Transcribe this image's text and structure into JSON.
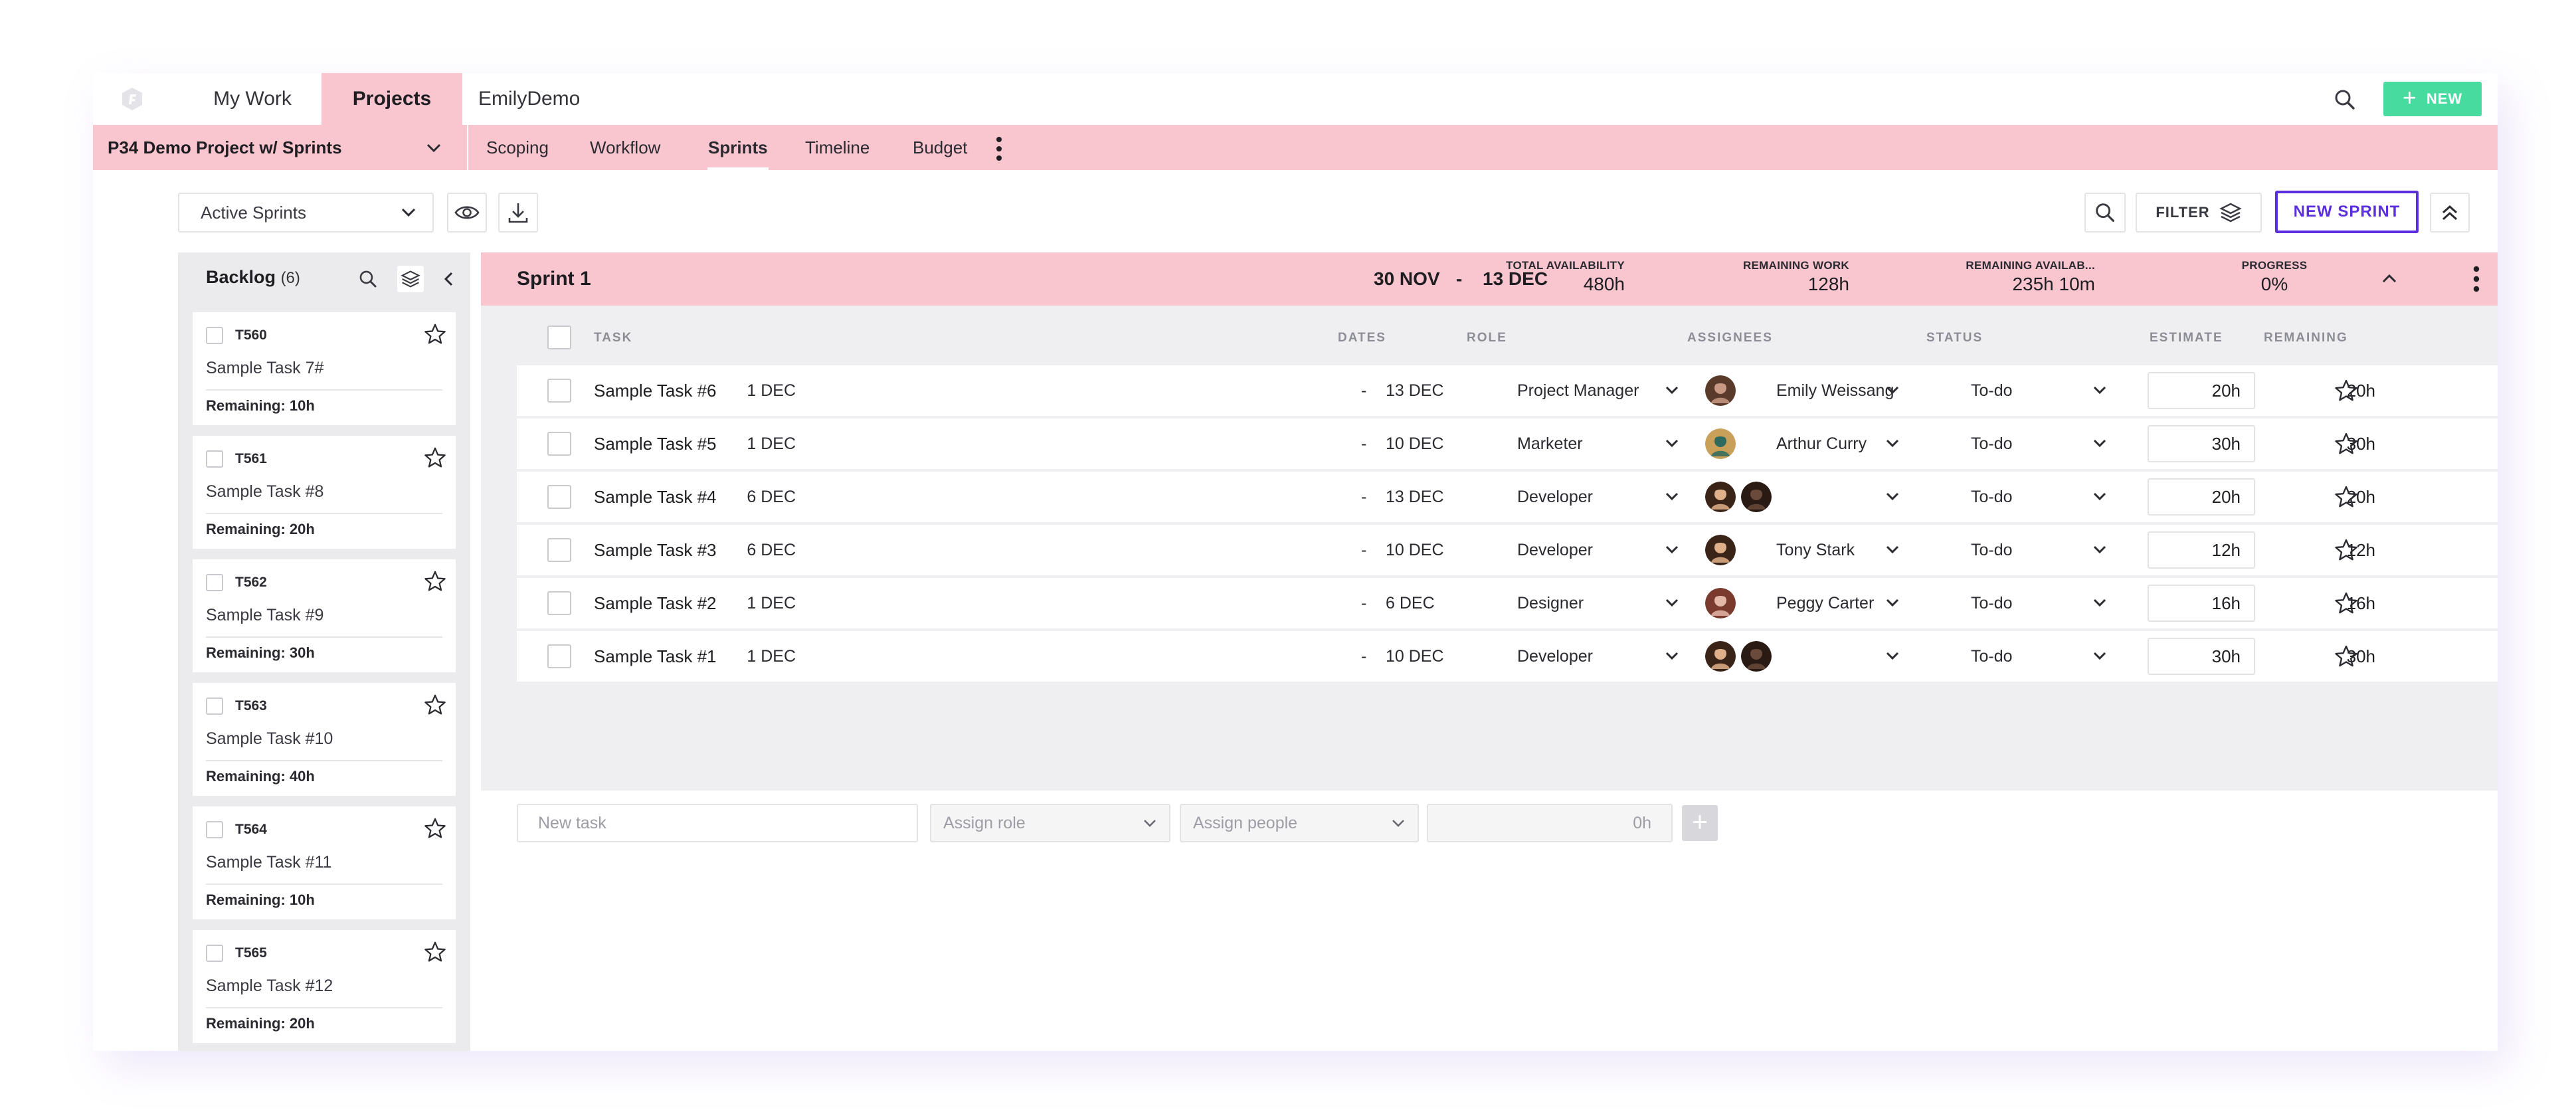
{
  "nav": {
    "tabs": [
      {
        "label": "My Work",
        "active": false
      },
      {
        "label": "Projects",
        "active": true
      },
      {
        "label": "EmilyDemo",
        "active": false
      }
    ],
    "new_button": "NEW"
  },
  "project": {
    "title": "P34 Demo Project w/ Sprints",
    "subtabs": [
      {
        "label": "Scoping",
        "active": false
      },
      {
        "label": "Workflow",
        "active": false
      },
      {
        "label": "Sprints",
        "active": true
      },
      {
        "label": "Timeline",
        "active": false
      },
      {
        "label": "Budget",
        "active": false
      }
    ]
  },
  "toolbar": {
    "sprint_filter_value": "Active Sprints",
    "filter_label": "FILTER",
    "new_sprint_label": "NEW SPRINT"
  },
  "backlog": {
    "title": "Backlog",
    "count": "(6)",
    "cards": [
      {
        "id": "T560",
        "name": "Sample Task 7#",
        "remaining": "Remaining: 10h"
      },
      {
        "id": "T561",
        "name": "Sample Task #8",
        "remaining": "Remaining: 20h"
      },
      {
        "id": "T562",
        "name": "Sample Task #9",
        "remaining": "Remaining: 30h"
      },
      {
        "id": "T563",
        "name": "Sample Task #10",
        "remaining": "Remaining: 40h"
      },
      {
        "id": "T564",
        "name": "Sample Task #11",
        "remaining": "Remaining: 10h"
      },
      {
        "id": "T565",
        "name": "Sample Task #12",
        "remaining": "Remaining: 20h"
      }
    ]
  },
  "sprint": {
    "name": "Sprint 1",
    "start": "30 NOV",
    "separator": "-",
    "end": "13 DEC",
    "stats": {
      "total_availability": {
        "label": "TOTAL AVAILABILITY",
        "value": "480h"
      },
      "remaining_work": {
        "label": "REMAINING WORK",
        "value": "128h"
      },
      "remaining_availability": {
        "label": "REMAINING AVAILAB...",
        "value": "235h 10m"
      },
      "progress": {
        "label": "PROGRESS",
        "value": "0%"
      }
    },
    "columns": {
      "task": "TASK",
      "dates": "DATES",
      "role": "ROLE",
      "assignees": "ASSIGNEES",
      "status": "STATUS",
      "estimate": "ESTIMATE",
      "remaining": "REMAINING"
    },
    "tasks": [
      {
        "name": "Sample Task #6",
        "start": "1 DEC",
        "sep": "-",
        "end": "13 DEC",
        "role": "Project Manager",
        "assignee": "Emily Weissang",
        "avatars": [
          "emily"
        ],
        "status": "To-do",
        "estimate": "20h",
        "remaining": "20h"
      },
      {
        "name": "Sample Task #5",
        "start": "1 DEC",
        "sep": "-",
        "end": "10 DEC",
        "role": "Marketer",
        "assignee": "Arthur Curry",
        "avatars": [
          "arthur"
        ],
        "status": "To-do",
        "estimate": "30h",
        "remaining": "30h"
      },
      {
        "name": "Sample Task #4",
        "start": "6 DEC",
        "sep": "-",
        "end": "13 DEC",
        "role": "Developer",
        "assignee": "",
        "avatars": [
          "tony",
          "dark"
        ],
        "status": "To-do",
        "estimate": "20h",
        "remaining": "20h"
      },
      {
        "name": "Sample Task #3",
        "start": "6 DEC",
        "sep": "-",
        "end": "10 DEC",
        "role": "Developer",
        "assignee": "Tony Stark",
        "avatars": [
          "tony"
        ],
        "status": "To-do",
        "estimate": "12h",
        "remaining": "12h"
      },
      {
        "name": "Sample Task #2",
        "start": "1 DEC",
        "sep": "-",
        "end": "6 DEC",
        "role": "Designer",
        "assignee": "Peggy Carter",
        "avatars": [
          "peggy"
        ],
        "status": "To-do",
        "estimate": "16h",
        "remaining": "16h"
      },
      {
        "name": "Sample Task #1",
        "start": "1 DEC",
        "sep": "-",
        "end": "10 DEC",
        "role": "Developer",
        "assignee": "",
        "avatars": [
          "tony",
          "dark"
        ],
        "status": "To-do",
        "estimate": "30h",
        "remaining": "30h"
      }
    ],
    "new_task": {
      "name_placeholder": "New task",
      "role_placeholder": "Assign role",
      "people_placeholder": "Assign people",
      "hours_value": "0h"
    }
  },
  "colors": {
    "pink_bar": "#f9c6d0",
    "new_button": "#47dba0",
    "accent_purple": "#5b2fe0",
    "panel_grey": "#efeff1"
  },
  "avatar_colors": {
    "emily": [
      "#c89a84",
      "#5a3a2a"
    ],
    "arthur": [
      "#2e6b5e",
      "#c9a05a"
    ],
    "tony": [
      "#e0b08a",
      "#3a2418"
    ],
    "dark": [
      "#6a4a3a",
      "#2a1a14"
    ],
    "peggy": [
      "#e4b8a8",
      "#7a3a2e"
    ]
  }
}
